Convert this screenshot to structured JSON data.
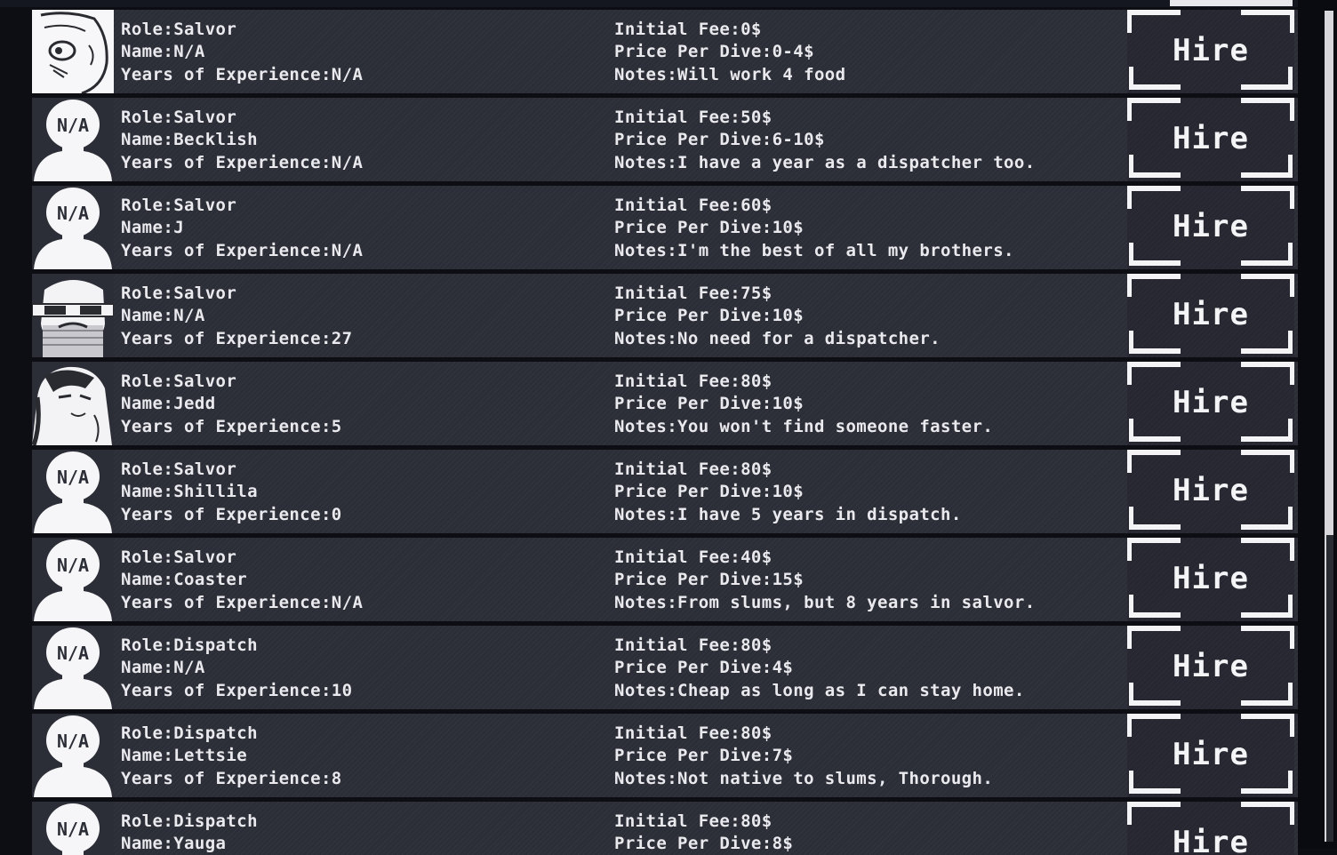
{
  "hire_label": "Hire",
  "applicants": [
    {
      "avatar": "doodle-face-icon",
      "role": "Role:Salvor",
      "name": "Name:N/A",
      "years": "Years of Experience:N/A",
      "fee": "Initial Fee:0$",
      "price": "Price Per Dive:0-4$",
      "notes": "Notes:Will work 4 food"
    },
    {
      "avatar": "placeholder-person-icon",
      "role": "Role:Salvor",
      "name": "Name:Becklish",
      "years": "Years of Experience:N/A",
      "fee": "Initial Fee:50$",
      "price": "Price Per Dive:6-10$",
      "notes": "Notes:I have a year as a dispatcher too."
    },
    {
      "avatar": "placeholder-person-icon",
      "role": "Role:Salvor",
      "name": "Name:J",
      "years": "Years of Experience:N/A",
      "fee": "Initial Fee:60$",
      "price": "Price Per Dive:10$",
      "notes": "Notes:I'm the best of all my brothers."
    },
    {
      "avatar": "bearded-man-icon",
      "role": "Role:Salvor",
      "name": "Name:N/A",
      "years": "Years of Experience:27",
      "fee": "Initial Fee:75$",
      "price": "Price Per Dive:10$",
      "notes": "Notes:No need for a dispatcher."
    },
    {
      "avatar": "long-hair-man-icon",
      "role": "Role:Salvor",
      "name": "Name:Jedd",
      "years": "Years of Experience:5",
      "fee": "Initial Fee:80$",
      "price": "Price Per Dive:10$",
      "notes": "Notes:You won't find someone faster."
    },
    {
      "avatar": "placeholder-person-icon",
      "role": "Role:Salvor",
      "name": "Name:Shillila",
      "years": "Years of Experience:0",
      "fee": "Initial Fee:80$",
      "price": "Price Per Dive:10$",
      "notes": "Notes:I have 5 years in dispatch."
    },
    {
      "avatar": "placeholder-person-icon",
      "role": "Role:Salvor",
      "name": "Name:Coaster",
      "years": "Years of Experience:N/A",
      "fee": "Initial Fee:40$",
      "price": "Price Per Dive:15$",
      "notes": "Notes:From slums, but 8 years in salvor."
    },
    {
      "avatar": "placeholder-person-icon",
      "role": "Role:Dispatch",
      "name": "Name:N/A",
      "years": "Years of Experience:10",
      "fee": "Initial Fee:80$",
      "price": "Price Per Dive:4$",
      "notes": "Notes:Cheap as long as I can stay home."
    },
    {
      "avatar": "placeholder-person-icon",
      "role": "Role:Dispatch",
      "name": "Name:Lettsie",
      "years": "Years of Experience:8",
      "fee": "Initial Fee:80$",
      "price": "Price Per Dive:7$",
      "notes": "Notes:Not native to slums, Thorough."
    },
    {
      "avatar": "placeholder-person-icon",
      "role": "Role:Dispatch",
      "name": "Name:Yauga",
      "years": "",
      "fee": "Initial Fee:80$",
      "price": "Price Per Dive:8$",
      "notes": ""
    }
  ]
}
